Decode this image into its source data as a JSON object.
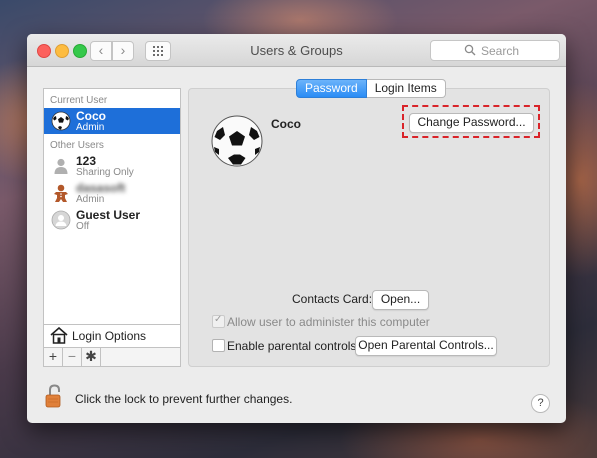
{
  "window": {
    "title": "Users & Groups"
  },
  "search": {
    "placeholder": "Search"
  },
  "sidebar": {
    "current_header": "Current User",
    "other_header": "Other Users",
    "current_user": {
      "name": "Coco",
      "role": "Admin",
      "icon": "soccer-ball-icon"
    },
    "other_users": [
      {
        "name": "123",
        "role": "Sharing Only",
        "icon": "person-icon"
      },
      {
        "name": "dasasoft",
        "role": "Admin",
        "icon": "gingerbread-icon"
      },
      {
        "name": "Guest User",
        "role": "Off",
        "icon": "guest-user-icon"
      }
    ],
    "login_options": "Login Options",
    "add": "+",
    "remove": "−"
  },
  "tabs": [
    {
      "label": "Password",
      "active": true
    },
    {
      "label": "Login Items",
      "active": false
    }
  ],
  "main": {
    "user_name": "Coco",
    "change_password": "Change Password...",
    "contacts_card_label": "Contacts Card:",
    "open_button": "Open...",
    "allow_admin": "Allow user to administer this computer",
    "enable_parental": "Enable parental controls",
    "open_parental": "Open Parental Controls..."
  },
  "footer": {
    "lock_text": "Click the lock to prevent further changes.",
    "help": "?"
  },
  "colors": {
    "selection": "#1e6fd9",
    "highlight": "#d9242a"
  }
}
